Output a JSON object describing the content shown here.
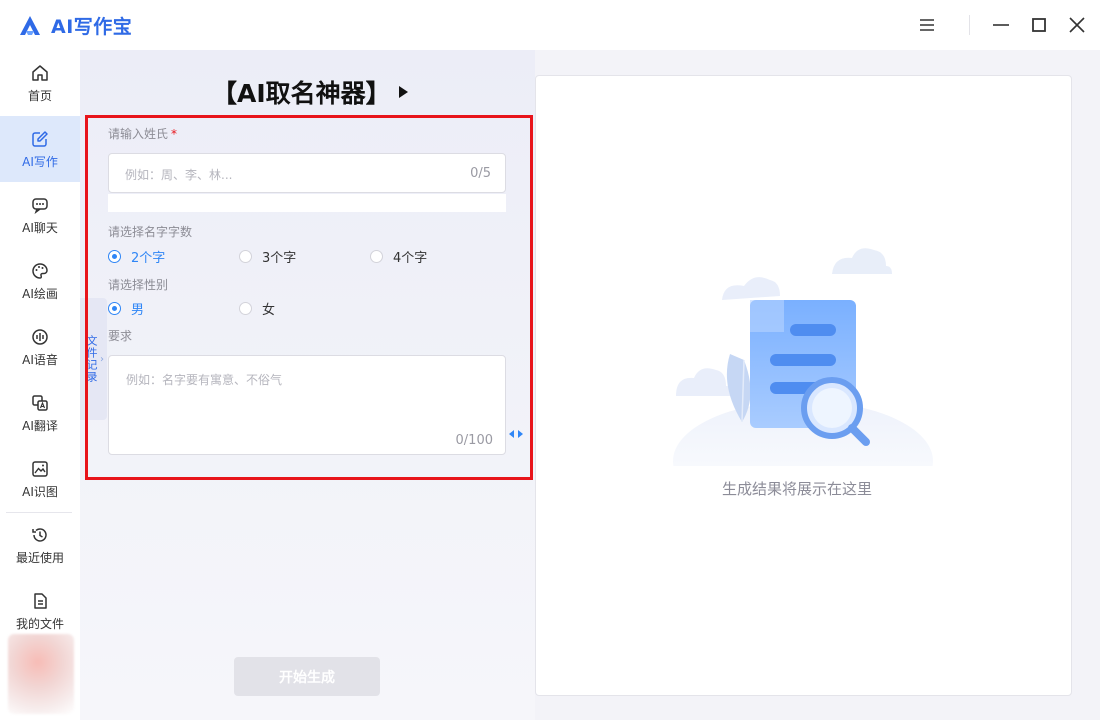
{
  "app": {
    "title": "AI写作宝"
  },
  "window_controls": [
    "menu-icon",
    "minimize-icon",
    "maximize-icon",
    "close-icon"
  ],
  "sidebar": {
    "items": [
      {
        "label": "首页",
        "icon": "home-icon"
      },
      {
        "label": "AI写作",
        "icon": "edit-icon",
        "active": true
      },
      {
        "label": "AI聊天",
        "icon": "chat-icon"
      },
      {
        "label": "AI绘画",
        "icon": "palette-icon"
      },
      {
        "label": "AI语音",
        "icon": "voice-icon"
      },
      {
        "label": "AI翻译",
        "icon": "translate-icon"
      },
      {
        "label": "AI识图",
        "icon": "image-recognition-icon"
      },
      {
        "label": "最近使用",
        "icon": "history-icon"
      },
      {
        "label": "我的文件",
        "icon": "file-icon"
      }
    ]
  },
  "tool": {
    "title": "【AI取名神器】"
  },
  "side_tab": {
    "label": "文件记录"
  },
  "form": {
    "surname": {
      "label": "请输入姓氏",
      "required_mark": "*",
      "placeholder": "例如：周、李、林...",
      "counter": "0/5"
    },
    "name_length": {
      "label": "请选择名字字数",
      "options": [
        "2个字",
        "3个字",
        "4个字"
      ],
      "selected": "2个字"
    },
    "gender": {
      "label": "请选择性别",
      "options": [
        "男",
        "女"
      ],
      "selected": "男"
    },
    "requirement": {
      "label": "要求",
      "placeholder": "例如：名字要有寓意、不俗气",
      "counter": "0/100"
    }
  },
  "generate_button": {
    "label": "开始生成"
  },
  "result": {
    "placeholder_text": "生成结果将展示在这里"
  },
  "colors": {
    "accent": "#2f6ae6",
    "radio_checked": "#2f86f6",
    "highlight_border": "#e8141b",
    "disabled_button": "#e2e2e8"
  }
}
